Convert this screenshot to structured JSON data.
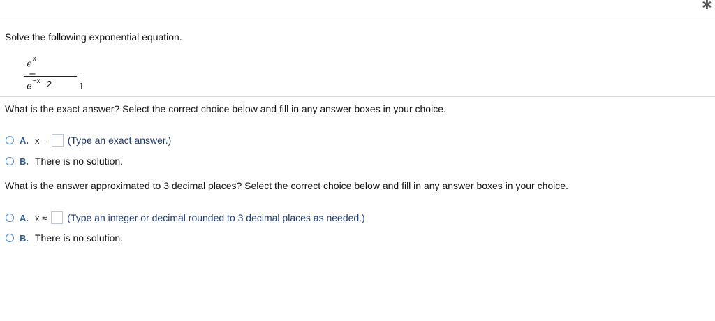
{
  "problem": {
    "prompt": "Solve the following exponential equation.",
    "equation": {
      "numerator_base1": "e",
      "numerator_exp1": "x",
      "operator": "−",
      "numerator_base2": "e",
      "numerator_exp2": "−x",
      "denominator": "2",
      "rhs": "= 1"
    }
  },
  "part1": {
    "question": "What is the exact answer? Select the correct choice below and fill in any answer boxes in your choice.",
    "choiceA": {
      "letter": "A.",
      "lhs": "x =",
      "hint": "(Type an exact answer.)"
    },
    "choiceB": {
      "letter": "B.",
      "text": "There is no solution."
    }
  },
  "part2": {
    "question": "What is the answer approximated to 3 decimal places? Select the correct choice below and fill in any answer boxes in your choice.",
    "choiceA": {
      "letter": "A.",
      "lhs": "x ≈",
      "hint": "(Type an integer or decimal rounded to 3 decimal places as needed.)"
    },
    "choiceB": {
      "letter": "B.",
      "text": "There is no solution."
    }
  },
  "icons": {
    "corner": "settings-gear-icon"
  }
}
